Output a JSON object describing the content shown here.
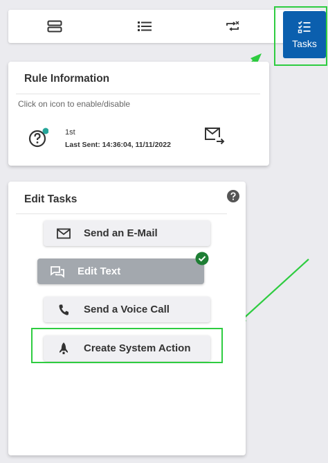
{
  "tabs": {
    "active_label": "Tasks"
  },
  "rule_info": {
    "title": "Rule Information",
    "hint": "Click on icon to enable/disable",
    "rank": "1st",
    "last_sent": "Last Sent: 14:36:04, 11/11/2022"
  },
  "edit_tasks": {
    "title": "Edit Tasks",
    "items": [
      {
        "label": "Send an E-Mail",
        "icon": "mail-icon"
      },
      {
        "label": "Edit Text",
        "icon": "chat-icon"
      },
      {
        "label": "Send a Voice Call",
        "icon": "phone-icon"
      },
      {
        "label": "Create System Action",
        "icon": "rocket-icon"
      }
    ]
  },
  "colors": {
    "accent": "#0b5fae",
    "annotation": "#2ecc40",
    "status_dot": "#26a69a",
    "check": "#1e7e34"
  }
}
